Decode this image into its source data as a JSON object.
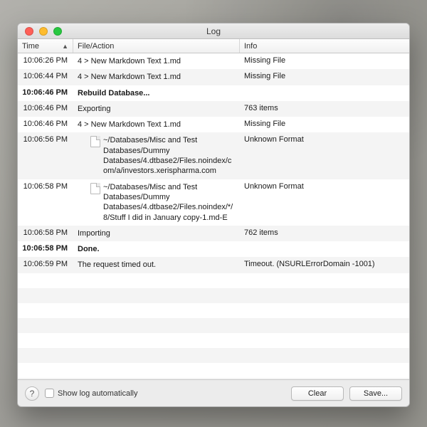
{
  "window": {
    "title": "Log"
  },
  "columns": {
    "time": "Time",
    "file": "File/Action",
    "info": "Info"
  },
  "rows": [
    {
      "time": "10:06:26 PM",
      "file": "4 > New Markdown Text 1.md",
      "info": "Missing File",
      "bold": false,
      "icon": false,
      "indent": false
    },
    {
      "time": "10:06:44 PM",
      "file": "4 > New Markdown Text 1.md",
      "info": "Missing File",
      "bold": false,
      "icon": false,
      "indent": false
    },
    {
      "time": "10:06:46 PM",
      "file": "Rebuild Database...",
      "info": "",
      "bold": true,
      "icon": false,
      "indent": false
    },
    {
      "time": "10:06:46 PM",
      "file": "Exporting",
      "info": "763 items",
      "bold": false,
      "icon": false,
      "indent": false
    },
    {
      "time": "10:06:46 PM",
      "file": "4 > New Markdown Text 1.md",
      "info": "Missing File",
      "bold": false,
      "icon": false,
      "indent": false
    },
    {
      "time": "10:06:56 PM",
      "file": "~/Databases/Misc and Test Databases/Dummy Databases/4.dtbase2/Files.noindex/com/a/investors.xerispharma.com",
      "info": "Unknown Format",
      "bold": false,
      "icon": true,
      "indent": true
    },
    {
      "time": "10:06:58 PM",
      "file": "~/Databases/Misc and Test Databases/Dummy Databases/4.dtbase2/Files.noindex/*/8/Stuff I did in January copy-1.md-E",
      "info": "Unknown Format",
      "bold": false,
      "icon": true,
      "indent": true
    },
    {
      "time": "10:06:58 PM",
      "file": "Importing",
      "info": "762 items",
      "bold": false,
      "icon": false,
      "indent": false
    },
    {
      "time": "10:06:58 PM",
      "file": "Done.",
      "info": "",
      "bold": true,
      "icon": false,
      "indent": false
    },
    {
      "time": "10:06:59 PM",
      "file": "The request timed out.",
      "info": "Timeout. (NSURLErrorDomain -1001)",
      "bold": false,
      "icon": false,
      "indent": false
    }
  ],
  "footer": {
    "show_log_label": "Show log automatically",
    "clear": "Clear",
    "save": "Save..."
  }
}
